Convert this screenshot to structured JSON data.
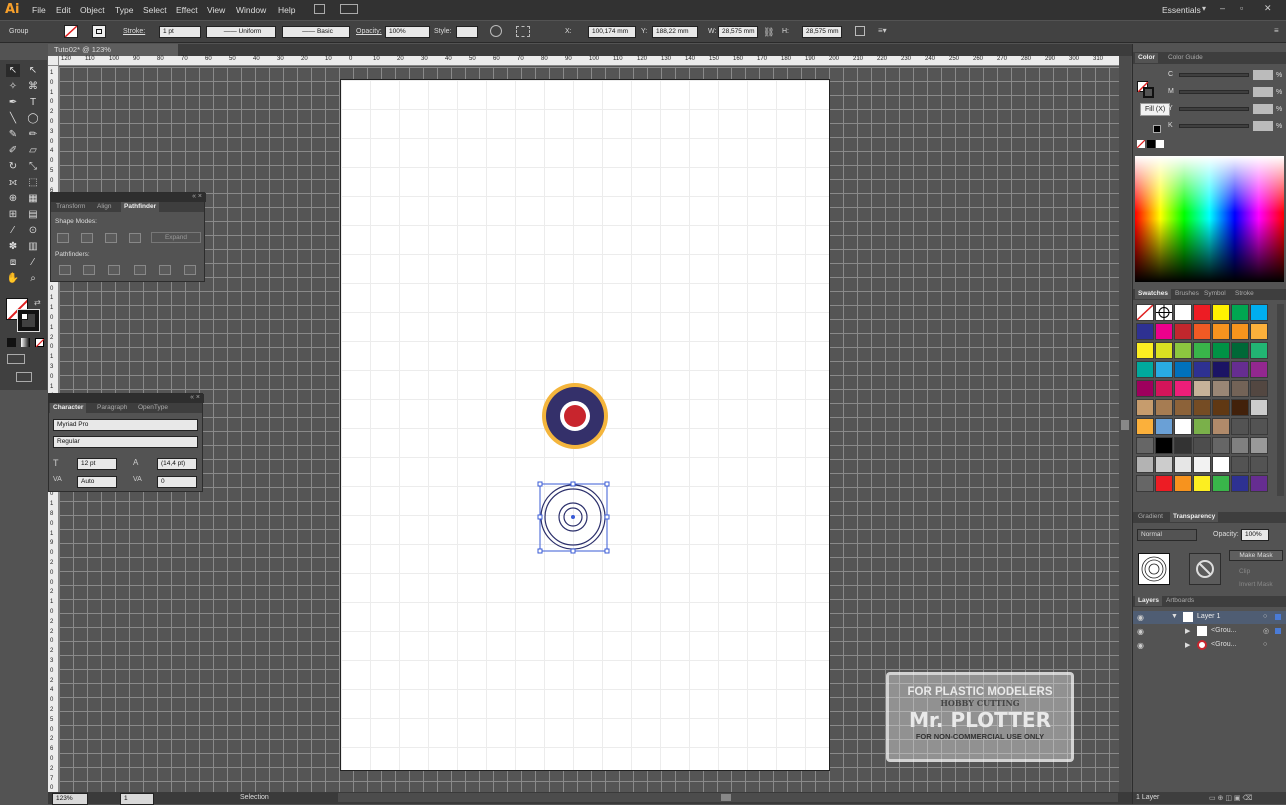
{
  "app": {
    "logo": "Ai",
    "workspace": "Essentials"
  },
  "menu": [
    "File",
    "Edit",
    "Object",
    "Type",
    "Select",
    "Effect",
    "View",
    "Window",
    "Help"
  ],
  "control": {
    "selection_type": "Group",
    "stroke_label": "Stroke:",
    "stroke_weight": "1 pt",
    "profile": "Uniform",
    "brush": "Basic",
    "opacity_label": "Opacity:",
    "opacity": "100%",
    "style_label": "Style:",
    "x_label": "X:",
    "x": "100,174 mm",
    "y_label": "Y:",
    "y": "188,22 mm",
    "w_label": "W:",
    "w": "28,575 mm",
    "h_label": "H:",
    "h": "28,575 mm"
  },
  "document": {
    "tab": "Tuto02* @ 123% (CMYK/Preview)"
  },
  "ruler": {
    "h": [
      "120",
      "110",
      "100",
      "90",
      "80",
      "70",
      "60",
      "50",
      "40",
      "30",
      "20",
      "10",
      "0",
      "10",
      "20",
      "30",
      "40",
      "50",
      "60",
      "70",
      "80",
      "90",
      "100",
      "110",
      "120",
      "130",
      "140",
      "150",
      "160",
      "170",
      "180",
      "190",
      "200",
      "210",
      "220",
      "230",
      "240",
      "250",
      "260",
      "270",
      "280",
      "290",
      "300",
      "310"
    ],
    "v": [
      "1",
      "0",
      "1",
      "0",
      "2",
      "0",
      "3",
      "0",
      "4",
      "0",
      "5",
      "0",
      "6",
      "0",
      "7",
      "0",
      "8",
      "0",
      "9",
      "0",
      "1",
      "0",
      "0",
      "1",
      "1",
      "0",
      "1",
      "2",
      "0",
      "1",
      "3",
      "0",
      "1",
      "4",
      "0",
      "1",
      "5",
      "0",
      "1",
      "6",
      "0",
      "1",
      "7",
      "0",
      "1",
      "8",
      "0",
      "1",
      "9",
      "0",
      "2",
      "0",
      "0",
      "2",
      "1",
      "0",
      "2",
      "2",
      "0",
      "2",
      "3",
      "0",
      "2",
      "4",
      "0",
      "2",
      "5",
      "0",
      "2",
      "6",
      "0",
      "2",
      "7",
      "0"
    ]
  },
  "pathfinder_panel": {
    "tabs": [
      "Transform",
      "Align",
      "Pathfinder"
    ],
    "shape_modes_label": "Shape Modes:",
    "expand": "Expand",
    "pathfinders_label": "Pathfinders:"
  },
  "character_panel": {
    "tabs": [
      "Character",
      "Paragraph",
      "OpenType"
    ],
    "font": "Myriad Pro",
    "style": "Regular",
    "size": "12 pt",
    "leading": "(14,4 pt)",
    "kerning": "Auto",
    "tracking": "0"
  },
  "color_panel": {
    "tabs": [
      "Color",
      "Color Guide"
    ],
    "channels": [
      "C",
      "M",
      "Y",
      "K"
    ],
    "unit": "%",
    "tooltip": "Fill (X)"
  },
  "swatches_panel": {
    "tabs": [
      "Swatches",
      "Brushes",
      "Symbol",
      "Stroke"
    ],
    "rows": [
      [
        "#ffffff",
        "#ffffff",
        "#ffffff",
        "#ed1c24",
        "#fff200",
        "#00a651",
        "#00aeef"
      ],
      [
        "#2e3192",
        "#ec008c",
        "#c1272d",
        "#f15a24",
        "#f7931e",
        "#f7941d",
        "#fbb03b"
      ],
      [
        "#fcee21",
        "#d9e021",
        "#8cc63f",
        "#39b54a",
        "#009245",
        "#006837",
        "#22b573"
      ],
      [
        "#00a99d",
        "#29abe2",
        "#0071bc",
        "#2e3192",
        "#1b1464",
        "#662d91",
        "#93278f"
      ],
      [
        "#9e005d",
        "#d4145a",
        "#ed1e79",
        "#c7b299",
        "#998675",
        "#736357",
        "#534741"
      ],
      [
        "#c69c6d",
        "#a67c52",
        "#8c6239",
        "#754c24",
        "#603813",
        "#42210b",
        "#cccccc"
      ],
      [
        "#fbb03b",
        "#6aa0d6",
        "#ffffff",
        "#7ab04a",
        "#b08a6a",
        "#535353",
        "#535353"
      ],
      [
        "#666666",
        "#000000",
        "#333333",
        "#4d4d4d",
        "#666666",
        "#808080",
        "#999999"
      ],
      [
        "#b3b3b3",
        "#cccccc",
        "#e6e6e6",
        "#f2f2f2",
        "#ffffff",
        "#535353",
        "#535353"
      ],
      [
        "#666666",
        "#ed1c24",
        "#f7931e",
        "#fcee21",
        "#39b54a",
        "#2e3192",
        "#662d91"
      ]
    ]
  },
  "transparency_panel": {
    "tabs": [
      "Gradient",
      "Transparency"
    ],
    "blend_mode": "Normal",
    "opacity_label": "Opacity:",
    "opacity": "100%",
    "make_mask": "Make Mask",
    "clip": "Clip",
    "invert_mask": "Invert Mask"
  },
  "layers_panel": {
    "tabs": [
      "Layers",
      "Artboards"
    ],
    "items": [
      {
        "name": "Layer 1"
      },
      {
        "name": "<Grou..."
      },
      {
        "name": "<Grou..."
      }
    ],
    "footer": "1 Layer"
  },
  "status": {
    "zoom": "123%",
    "artboard": "1",
    "tool": "Selection"
  },
  "watermark": {
    "line1": "FOR PLASTIC MODELERS",
    "line2": "HOBBY CUTTING",
    "line3": "Mr. PLOTTER",
    "line4": "FOR NON-COMMERCIAL USE ONLY"
  },
  "colors": {
    "roundel_navy": "#34306a",
    "roundel_yellow": "#f4b53c",
    "roundel_red": "#c8252d",
    "selection_blue": "#3a5bd6",
    "outline_navy": "#2b2f6b"
  }
}
